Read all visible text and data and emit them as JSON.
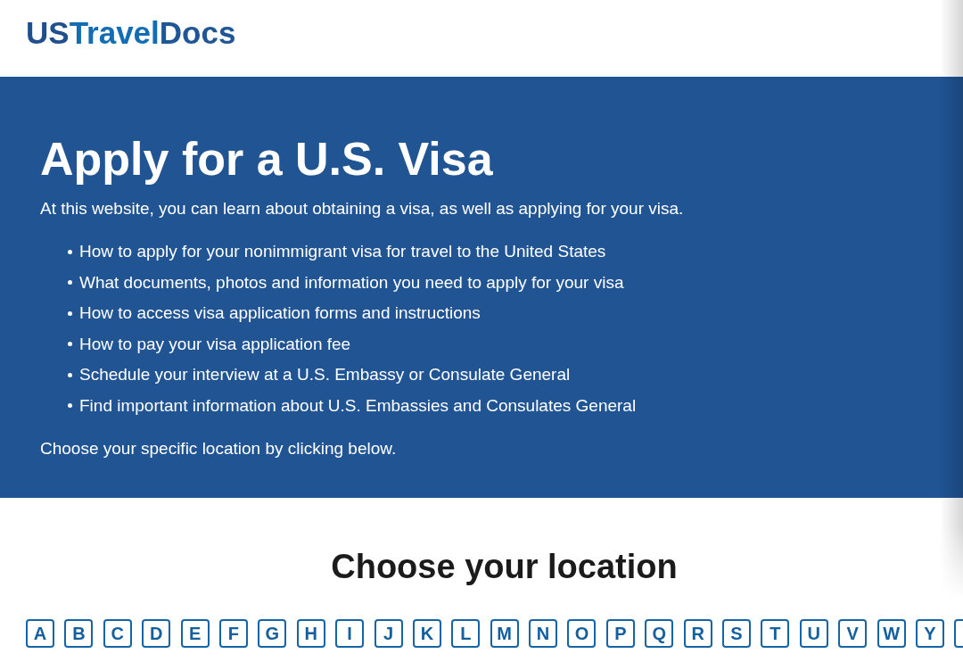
{
  "header": {
    "logo": [
      {
        "text": "US",
        "color": "#1f4f8f"
      },
      {
        "text": "Travel",
        "color": "#126db5"
      },
      {
        "text": "Docs",
        "color": "#1f5696"
      }
    ]
  },
  "hero": {
    "title": "Apply for a U.S. Visa",
    "intro": "At this website, you can learn about obtaining a visa, as well as applying for your visa.",
    "items": [
      "How to apply for your nonimmigrant visa for travel to the United States",
      "What documents, photos and information you need to apply for your visa",
      "How to access visa application forms and instructions",
      "How to pay your visa application fee",
      "Schedule your interview at a U.S. Embassy or Consulate General",
      "Find important information about U.S. Embassies and Consulates General"
    ],
    "prompt": "Choose your specific location by clicking below."
  },
  "location_picker": {
    "heading": "Choose your location",
    "letters": [
      "A",
      "B",
      "C",
      "D",
      "E",
      "F",
      "G",
      "H",
      "I",
      "J",
      "K",
      "L",
      "M",
      "N",
      "O",
      "P",
      "Q",
      "R",
      "S",
      "T",
      "U",
      "V",
      "W",
      "Y"
    ],
    "cut_off_box": true
  }
}
